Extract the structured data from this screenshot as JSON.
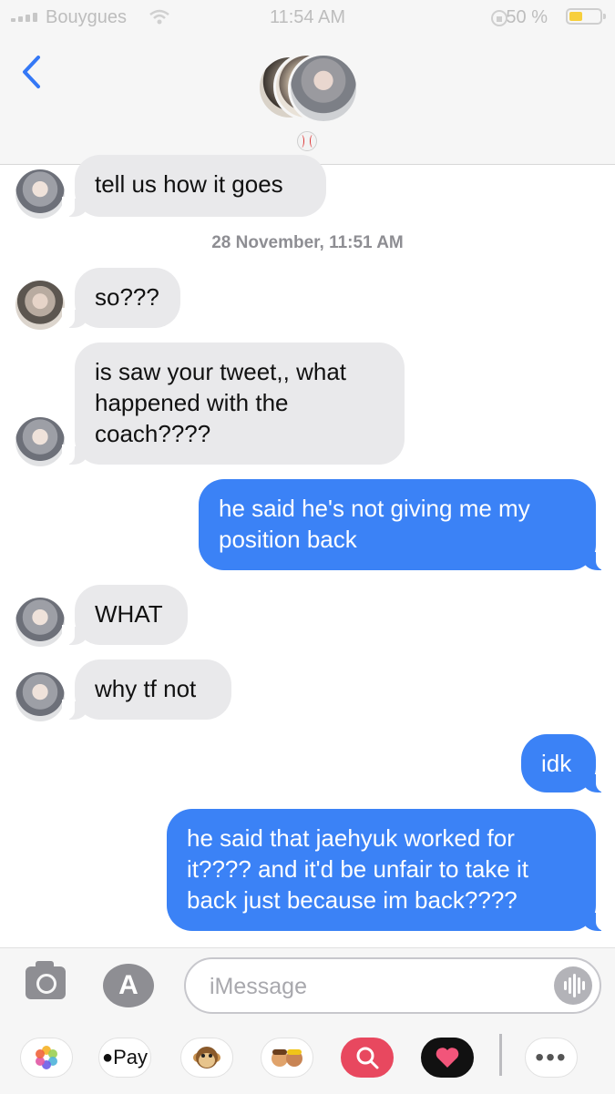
{
  "status_bar": {
    "carrier": "Bouygues",
    "time": "11:54 AM",
    "battery": "50 %"
  },
  "header": {
    "back_icon": "chevron-left-icon",
    "group_icon": "baseball-icon"
  },
  "timestamp": "28 November, 11:51 AM",
  "messages": [
    {
      "dir": "received",
      "text": "tell us how it goes"
    },
    {
      "dir": "received",
      "text": "so???"
    },
    {
      "dir": "received",
      "text": "is saw your tweet,, what happened with the coach????"
    },
    {
      "dir": "sent",
      "text": "he said he's not giving me my position back"
    },
    {
      "dir": "received",
      "text": "WHAT"
    },
    {
      "dir": "received",
      "text": "why tf not"
    },
    {
      "dir": "sent",
      "text": "idk"
    },
    {
      "dir": "sent",
      "text": "he said that jaehyuk worked for it???? and it'd be unfair to take it back just because im back????"
    }
  ],
  "composer": {
    "placeholder": "iMessage",
    "apple_pay": "Pay"
  },
  "colors": {
    "sent_bubble": "#3b82f6",
    "received_bubble": "#e9e9eb"
  }
}
